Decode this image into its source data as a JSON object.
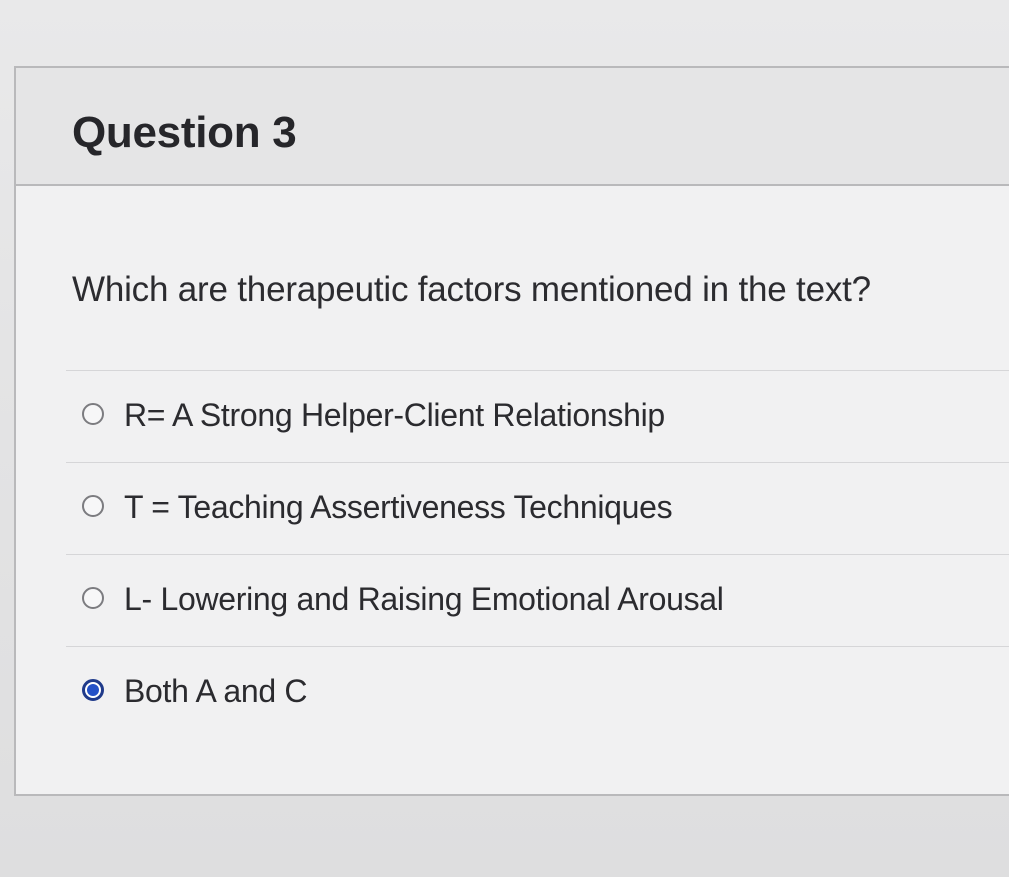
{
  "question": {
    "title": "Question 3",
    "prompt": "Which are therapeutic factors mentioned in the text?",
    "answers": [
      {
        "label": "R= A Strong Helper-Client Relationship",
        "selected": false
      },
      {
        "label": "T = Teaching Assertiveness Techniques",
        "selected": false
      },
      {
        "label": "L- Lowering and Raising Emotional Arousal",
        "selected": false
      },
      {
        "label": "Both A and C",
        "selected": true
      }
    ]
  },
  "colors": {
    "selected_radio": "#2451c7",
    "header_background": "#e5e5e6",
    "card_border": "#b9b9bb"
  }
}
